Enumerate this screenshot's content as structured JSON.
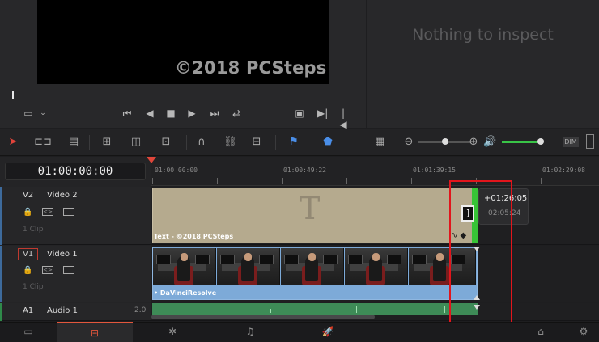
{
  "viewer": {
    "watermark": "©2018 PCSteps",
    "transport": [
      "crop-icon",
      "skip-back-icon",
      "step-back-icon",
      "stop-icon",
      "play-icon",
      "skip-forward-icon",
      "loop-icon",
      "fullscreen-icon",
      "next-edit-icon",
      "prev-edit-icon"
    ]
  },
  "inspector": {
    "message": "Nothing to inspect"
  },
  "toolbar": {
    "tools": [
      "selection-icon",
      "trim-icon",
      "blade-mode-icon",
      "insert-clip-icon",
      "overwrite-clip-icon",
      "replace-clip-icon",
      "snapping-icon",
      "linked-selection-icon",
      "position-lock-icon",
      "flag-icon",
      "marker-icon",
      "track-view-icon",
      "zoom-out-icon",
      "zoom-in-icon",
      "volume-icon"
    ],
    "dim_label": "DIM"
  },
  "timecode": "01:00:00:00",
  "ruler": {
    "labels": [
      "01:00:00:00",
      "01:00:49:22",
      "01:01:39:15",
      "01:02:29:08"
    ]
  },
  "tracks": [
    {
      "id": "V2",
      "name": "Video 2",
      "count": "1 Clip",
      "clip_label": "Text - ©2018 PCSteps",
      "glyph": "T"
    },
    {
      "id": "V1",
      "name": "Video 1",
      "count": "1 Clip",
      "clip_label": "• DaVinciResolve"
    },
    {
      "id": "A1",
      "name": "Audio 1",
      "level": "2.0"
    }
  ],
  "trim_tooltip": {
    "offset": "+01:26:05",
    "duration": "02:05:24"
  },
  "pages": [
    "media-page-icon",
    "edit-page-icon",
    "fusion-page-icon",
    "fairlight-page-icon",
    "deliver-page-icon",
    "home-icon",
    "settings-icon"
  ],
  "colors": {
    "accent": "#e2563c",
    "annotation": "#e2151c",
    "video_clip": "#7daad8",
    "text_clip": "#b5aa8e",
    "audio_clip": "#3e8b57",
    "trim_green": "#37c437"
  }
}
